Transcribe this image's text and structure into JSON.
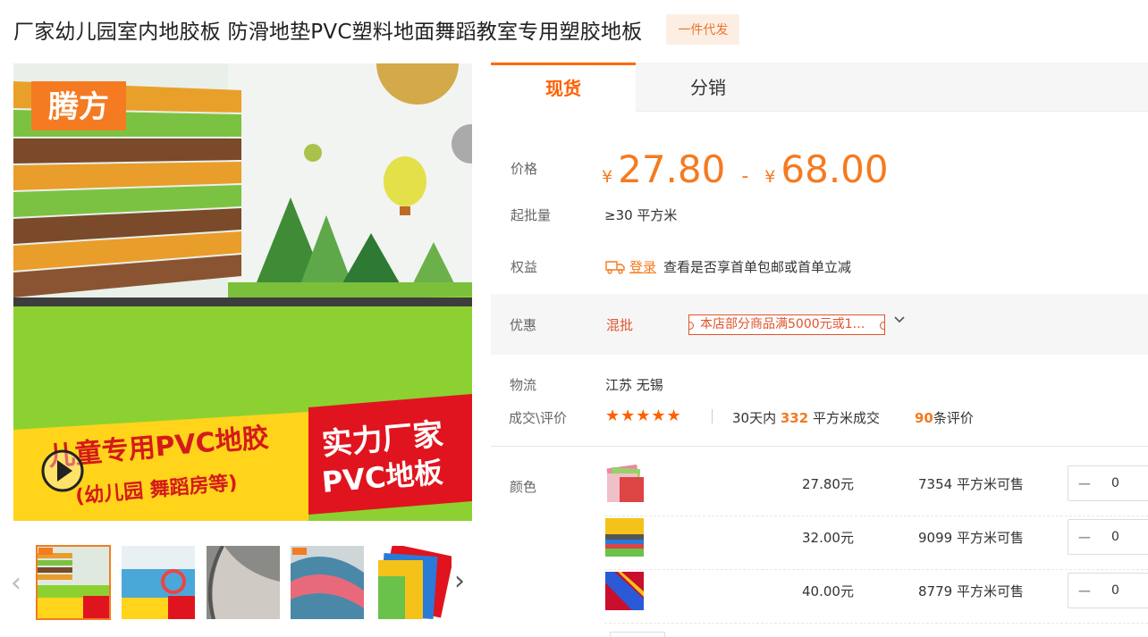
{
  "header": {
    "title": "厂家幼儿园室内地胶板 防滑地垫PVC塑料地面舞蹈教室专用塑胶地板",
    "tag": "一件代发"
  },
  "gallery": {
    "main_image": {
      "brand": "腾方",
      "left_line1": "儿童专用PVC地胶",
      "left_line2": "(幼儿园 舞蹈房等)",
      "right_line1": "实力厂家",
      "right_line2": "PVC地板"
    },
    "thumbnails": [
      "thumbnail-1",
      "thumbnail-2",
      "thumbnail-3",
      "thumbnail-4",
      "thumbnail-5"
    ]
  },
  "tabs": [
    {
      "label": "现货",
      "active": true
    },
    {
      "label": "分销",
      "active": false
    }
  ],
  "price": {
    "label": "价格",
    "currency": "¥",
    "min": "27.80",
    "sep": "-",
    "max": "68.00"
  },
  "moq": {
    "label": "起批量",
    "value": "≥30  平方米"
  },
  "benefits": {
    "label": "权益",
    "login": "登录",
    "text": "查看是否享首单包邮或首单立减"
  },
  "promo": {
    "label": "优惠",
    "type": "混批",
    "coupon": "本店部分商品满5000元或1…"
  },
  "logistics": {
    "label": "物流",
    "value": "江苏 无锡"
  },
  "deals": {
    "label": "成交\\评价",
    "stars": "★★★★★",
    "rating": 5,
    "prefix": "30天内",
    "count": "332",
    "suffix": "平方米成交",
    "reviews": "90",
    "reviews_suffix": "条评价"
  },
  "sku": {
    "label": "颜色",
    "rows": [
      {
        "price": "27.80元",
        "stock": "7354 平方米可售",
        "qty": "0"
      },
      {
        "price": "32.00元",
        "stock": "9099 平方米可售",
        "qty": "0"
      },
      {
        "price": "40.00元",
        "stock": "8779 平方米可售",
        "qty": "0"
      }
    ]
  },
  "colors": {
    "accent": "#ff6a00",
    "price": "#f57a1f",
    "promo": "#e0542c",
    "tag_bg": "#fdeee4"
  }
}
